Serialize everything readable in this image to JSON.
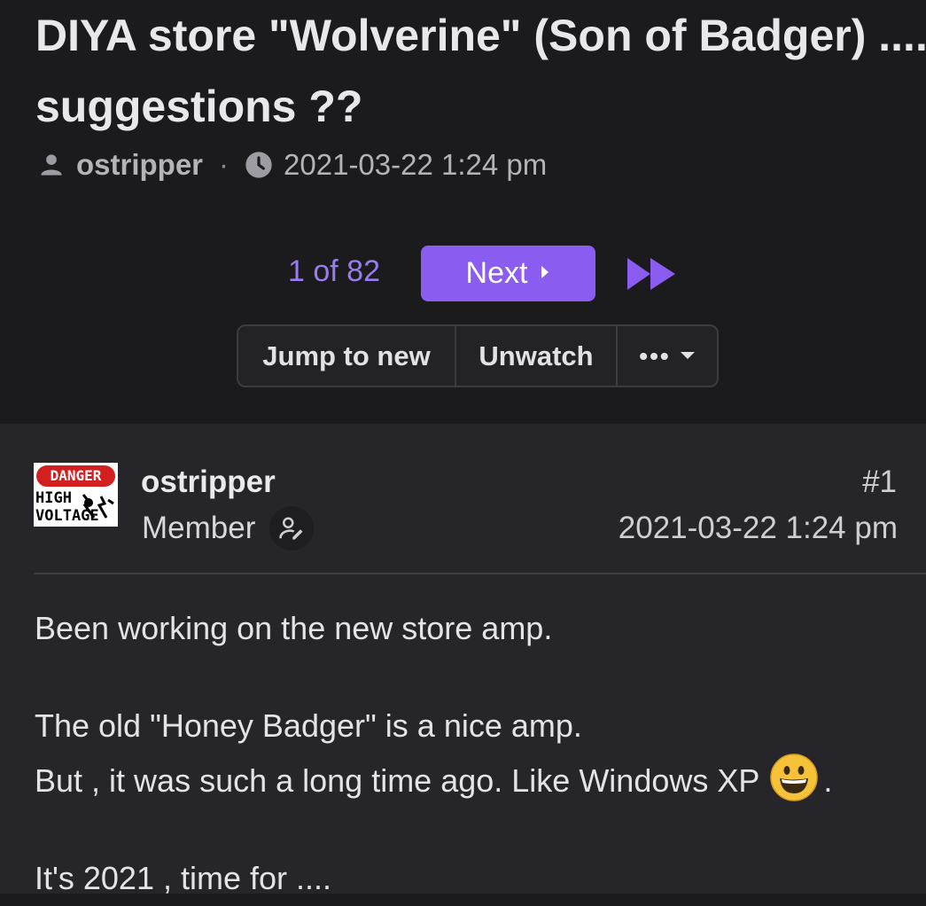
{
  "thread": {
    "title": "DIYA store \"Wolverine\" (Son of Badger) .... suggestions ??",
    "author": "ostripper",
    "separator": "·",
    "date": "2021-03-22 1:24 pm"
  },
  "pager": {
    "page_count": "1 of 82",
    "next_label": "Next"
  },
  "actions": {
    "jump_label": "Jump to new",
    "unwatch_label": "Unwatch",
    "more_label": "•••"
  },
  "post": {
    "avatar": {
      "danger_text": "DANGER",
      "line1": "HIGH",
      "line2": "VOLTAGE"
    },
    "username": "ostripper",
    "role": "Member",
    "number": "#1",
    "date": "2021-03-22 1:24 pm",
    "body": {
      "p1": "Been working on the new store amp.",
      "p2": "The old \"Honey Badger\" is a nice amp.",
      "p3": "But , it was such a long time ago. Like Windows XP",
      "p3_end": ".",
      "p4": "It's 2021 , time for ...."
    }
  },
  "colors": {
    "accent": "#8b5cf0",
    "page_count": "#9a7bf0",
    "header_bg": "#1b1b1d",
    "post_bg": "#26262a"
  },
  "icons": [
    "person-icon",
    "clock-icon",
    "chevron-right-icon",
    "fast-forward-icon",
    "caret-down-icon",
    "edit-user-icon",
    "grinning-emoji-icon"
  ]
}
